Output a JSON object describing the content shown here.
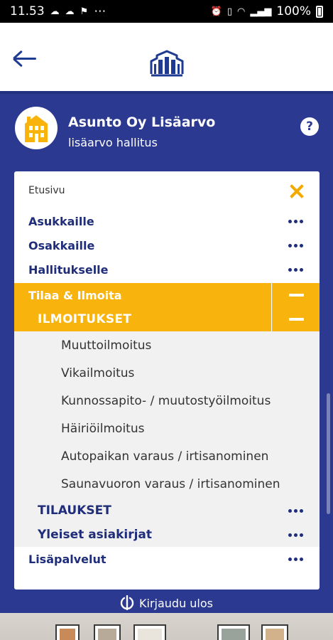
{
  "status_bar": {
    "time": "11.53",
    "notification_icons": [
      "cloud-icon",
      "cloud-icon",
      "flag-icon"
    ],
    "more": "⋯",
    "battery": "100%"
  },
  "header": {
    "back_icon": "arrow-left-icon",
    "logo_icon": "building-logo-icon"
  },
  "company": {
    "name": "Asunto Oy Lisäarvo",
    "role": "lisäarvo hallitus",
    "help_icon": "?"
  },
  "menu": {
    "home": "Etusivu",
    "items": [
      {
        "label": "Asukkaille"
      },
      {
        "label": "Osakkaille"
      },
      {
        "label": "Hallitukselle"
      }
    ],
    "active_section": "Tilaa & Ilmoita",
    "active_subsection": "ILMOITUKSET",
    "sub_items": [
      {
        "label": "Muuttoilmoitus"
      },
      {
        "label": "Vikailmoitus"
      },
      {
        "label": "Kunnossapito- / muutostyöilmoitus"
      },
      {
        "label": "Häiriöilmoitus"
      },
      {
        "label": "Autopaikan varaus / irtisanominen"
      },
      {
        "label": "Saunavuoron varaus / irtisanominen"
      }
    ],
    "sections": [
      {
        "label": "TILAUKSET"
      },
      {
        "label": "Yleiset asiakirjat"
      }
    ],
    "extra": "Lisäpalvelut"
  },
  "logout": {
    "label": "Kirjaudu ulos"
  },
  "colors": {
    "primary": "#2b3990",
    "accent": "#f9b30d",
    "dark_text": "#1f2d7a"
  }
}
